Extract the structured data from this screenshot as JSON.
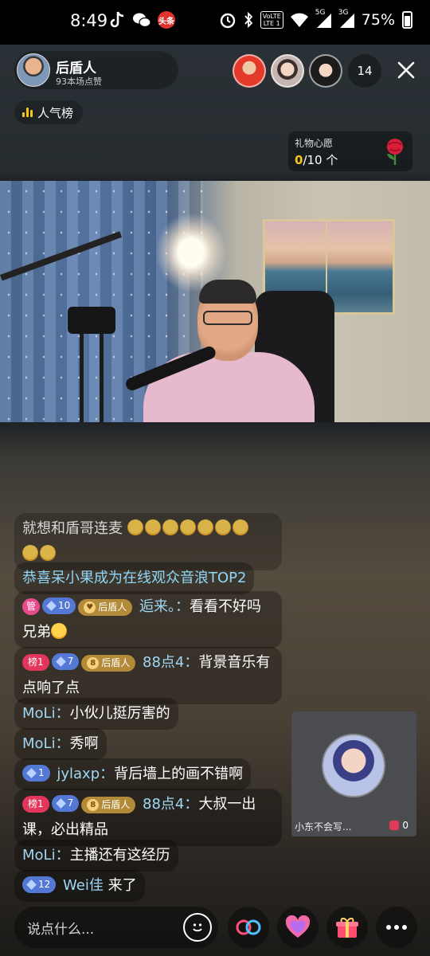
{
  "status_bar": {
    "time": "8:49",
    "left_icons": [
      "tiktok-icon",
      "wechat-icon",
      "toutiao-icon"
    ],
    "toutiao_label": "头条",
    "right_icons": [
      "alarm-icon",
      "bluetooth-icon",
      "volte-icon",
      "wifi-icon",
      "signal-5g-icon",
      "signal-3g-icon",
      "battery-icon"
    ],
    "lte_top": "VoLTE",
    "lte_bottom": "LTE 1",
    "net1": "5G",
    "net2": "3G",
    "battery": "75%"
  },
  "host": {
    "name": "后盾人",
    "likes": "93本场点赞"
  },
  "viewers": {
    "count": "14"
  },
  "rank_label": "人气榜",
  "wish": {
    "title": "礼物心愿",
    "current": "0",
    "target": "/10 个"
  },
  "chat": [
    {
      "text": "就想和盾哥连麦"
    },
    {
      "text": "恭喜呆小果成为在线观众音浪TOP2"
    },
    {
      "tag_guan": "管",
      "tag_lvl": "10",
      "tag_fan": "后盾人",
      "nick": "逅来。",
      "sep": "：",
      "text": "看看不好吗兄弟"
    },
    {
      "tag_bang": "榜1",
      "tag_lvl": "7",
      "tag_fan_lvl": "8",
      "tag_fan": "后盾人",
      "nick": "88点4",
      "sep": "：",
      "text": "背景音乐有点响了点"
    },
    {
      "nick": "MoLi",
      "sep": "：",
      "text": "小伙儿挺厉害的"
    },
    {
      "nick": "MoLi",
      "sep": "：",
      "text": "秀啊"
    },
    {
      "tag_lvl": "1",
      "nick": "jylaxp",
      "sep": "：",
      "text": "背后墙上的画不错啊"
    },
    {
      "tag_bang": "榜1",
      "tag_lvl": "7",
      "tag_fan_lvl": "8",
      "tag_fan": "后盾人",
      "nick": "88点4",
      "sep": "：",
      "text": "大叔一出课，必出精品"
    },
    {
      "nick": "MoLi",
      "sep": "：",
      "text": "主播还有这经历"
    },
    {
      "tag_lvl": "12",
      "nick": "Wei佳",
      "text": "来了"
    }
  ],
  "pip": {
    "name": "小东不会写...",
    "likes": "0"
  },
  "bottom": {
    "placeholder": "说点什么..."
  },
  "colors": {
    "nick": "#9fd7f5",
    "accent_yellow": "#f5c518",
    "rank_red": "#e3365c",
    "level_blue": "#5478d6",
    "fan_gold": "#b38a38"
  }
}
